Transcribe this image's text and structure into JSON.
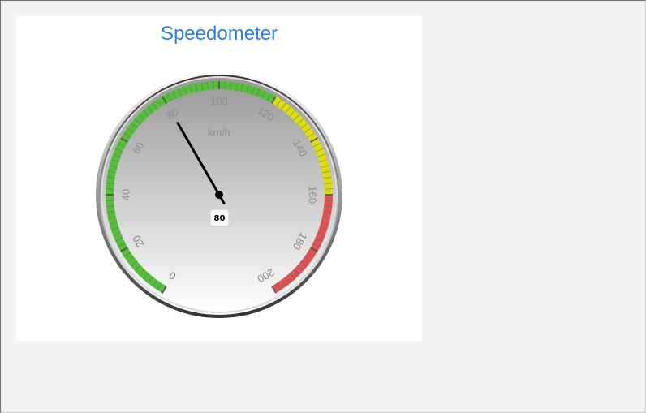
{
  "chart_data": {
    "type": "gauge",
    "title": "Speedometer",
    "unit": "km/h",
    "min": 0,
    "max": 200,
    "value": 80,
    "value_label": "80",
    "tick_labels": [
      "0",
      "20",
      "40",
      "60",
      "80",
      "100",
      "120",
      "140",
      "160",
      "180",
      "200"
    ],
    "bands": [
      {
        "from": 0,
        "to": 120,
        "color": "#55bf3b"
      },
      {
        "from": 120,
        "to": 160,
        "color": "#dddf0d"
      },
      {
        "from": 160,
        "to": 200,
        "color": "#df5353"
      }
    ]
  }
}
